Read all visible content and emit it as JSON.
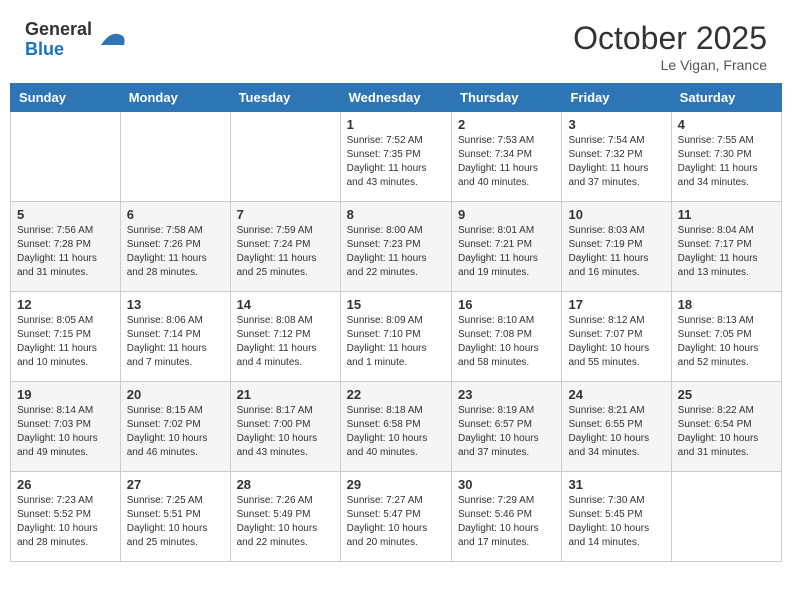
{
  "header": {
    "logo_general": "General",
    "logo_blue": "Blue",
    "month": "October 2025",
    "location": "Le Vigan, France"
  },
  "days_of_week": [
    "Sunday",
    "Monday",
    "Tuesday",
    "Wednesday",
    "Thursday",
    "Friday",
    "Saturday"
  ],
  "weeks": [
    [
      {
        "day": "",
        "info": ""
      },
      {
        "day": "",
        "info": ""
      },
      {
        "day": "",
        "info": ""
      },
      {
        "day": "1",
        "info": "Sunrise: 7:52 AM\nSunset: 7:35 PM\nDaylight: 11 hours and 43 minutes."
      },
      {
        "day": "2",
        "info": "Sunrise: 7:53 AM\nSunset: 7:34 PM\nDaylight: 11 hours and 40 minutes."
      },
      {
        "day": "3",
        "info": "Sunrise: 7:54 AM\nSunset: 7:32 PM\nDaylight: 11 hours and 37 minutes."
      },
      {
        "day": "4",
        "info": "Sunrise: 7:55 AM\nSunset: 7:30 PM\nDaylight: 11 hours and 34 minutes."
      }
    ],
    [
      {
        "day": "5",
        "info": "Sunrise: 7:56 AM\nSunset: 7:28 PM\nDaylight: 11 hours and 31 minutes."
      },
      {
        "day": "6",
        "info": "Sunrise: 7:58 AM\nSunset: 7:26 PM\nDaylight: 11 hours and 28 minutes."
      },
      {
        "day": "7",
        "info": "Sunrise: 7:59 AM\nSunset: 7:24 PM\nDaylight: 11 hours and 25 minutes."
      },
      {
        "day": "8",
        "info": "Sunrise: 8:00 AM\nSunset: 7:23 PM\nDaylight: 11 hours and 22 minutes."
      },
      {
        "day": "9",
        "info": "Sunrise: 8:01 AM\nSunset: 7:21 PM\nDaylight: 11 hours and 19 minutes."
      },
      {
        "day": "10",
        "info": "Sunrise: 8:03 AM\nSunset: 7:19 PM\nDaylight: 11 hours and 16 minutes."
      },
      {
        "day": "11",
        "info": "Sunrise: 8:04 AM\nSunset: 7:17 PM\nDaylight: 11 hours and 13 minutes."
      }
    ],
    [
      {
        "day": "12",
        "info": "Sunrise: 8:05 AM\nSunset: 7:15 PM\nDaylight: 11 hours and 10 minutes."
      },
      {
        "day": "13",
        "info": "Sunrise: 8:06 AM\nSunset: 7:14 PM\nDaylight: 11 hours and 7 minutes."
      },
      {
        "day": "14",
        "info": "Sunrise: 8:08 AM\nSunset: 7:12 PM\nDaylight: 11 hours and 4 minutes."
      },
      {
        "day": "15",
        "info": "Sunrise: 8:09 AM\nSunset: 7:10 PM\nDaylight: 11 hours and 1 minute."
      },
      {
        "day": "16",
        "info": "Sunrise: 8:10 AM\nSunset: 7:08 PM\nDaylight: 10 hours and 58 minutes."
      },
      {
        "day": "17",
        "info": "Sunrise: 8:12 AM\nSunset: 7:07 PM\nDaylight: 10 hours and 55 minutes."
      },
      {
        "day": "18",
        "info": "Sunrise: 8:13 AM\nSunset: 7:05 PM\nDaylight: 10 hours and 52 minutes."
      }
    ],
    [
      {
        "day": "19",
        "info": "Sunrise: 8:14 AM\nSunset: 7:03 PM\nDaylight: 10 hours and 49 minutes."
      },
      {
        "day": "20",
        "info": "Sunrise: 8:15 AM\nSunset: 7:02 PM\nDaylight: 10 hours and 46 minutes."
      },
      {
        "day": "21",
        "info": "Sunrise: 8:17 AM\nSunset: 7:00 PM\nDaylight: 10 hours and 43 minutes."
      },
      {
        "day": "22",
        "info": "Sunrise: 8:18 AM\nSunset: 6:58 PM\nDaylight: 10 hours and 40 minutes."
      },
      {
        "day": "23",
        "info": "Sunrise: 8:19 AM\nSunset: 6:57 PM\nDaylight: 10 hours and 37 minutes."
      },
      {
        "day": "24",
        "info": "Sunrise: 8:21 AM\nSunset: 6:55 PM\nDaylight: 10 hours and 34 minutes."
      },
      {
        "day": "25",
        "info": "Sunrise: 8:22 AM\nSunset: 6:54 PM\nDaylight: 10 hours and 31 minutes."
      }
    ],
    [
      {
        "day": "26",
        "info": "Sunrise: 7:23 AM\nSunset: 5:52 PM\nDaylight: 10 hours and 28 minutes."
      },
      {
        "day": "27",
        "info": "Sunrise: 7:25 AM\nSunset: 5:51 PM\nDaylight: 10 hours and 25 minutes."
      },
      {
        "day": "28",
        "info": "Sunrise: 7:26 AM\nSunset: 5:49 PM\nDaylight: 10 hours and 22 minutes."
      },
      {
        "day": "29",
        "info": "Sunrise: 7:27 AM\nSunset: 5:47 PM\nDaylight: 10 hours and 20 minutes."
      },
      {
        "day": "30",
        "info": "Sunrise: 7:29 AM\nSunset: 5:46 PM\nDaylight: 10 hours and 17 minutes."
      },
      {
        "day": "31",
        "info": "Sunrise: 7:30 AM\nSunset: 5:45 PM\nDaylight: 10 hours and 14 minutes."
      },
      {
        "day": "",
        "info": ""
      }
    ]
  ]
}
